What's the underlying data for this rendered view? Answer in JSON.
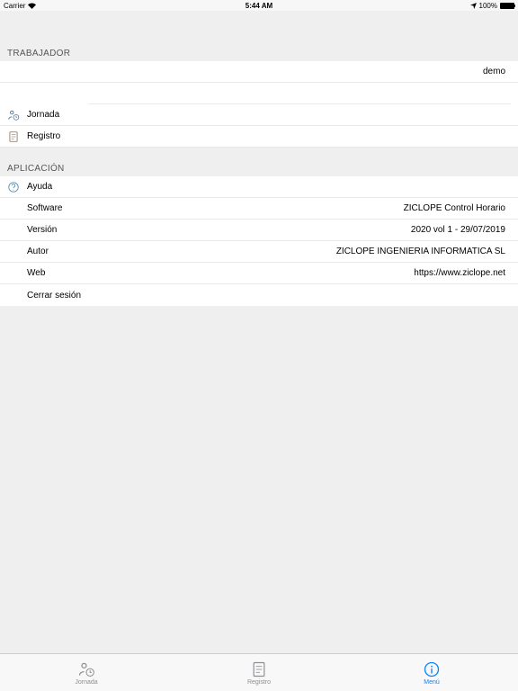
{
  "status": {
    "carrier": "Carrier",
    "time": "5:44 AM",
    "battery": "100%"
  },
  "sections": {
    "trabajador": {
      "header": "TRABAJADOR",
      "user": "demo",
      "jornada": "Jornada",
      "registro": "Registro"
    },
    "aplicacion": {
      "header": "APLICACIÓN",
      "ayuda": "Ayuda",
      "software_label": "Software",
      "software_value": "ZICLOPE Control Horario",
      "version_label": "Versión",
      "version_value": "2020 vol 1 - 29/07/2019",
      "autor_label": "Autor",
      "autor_value": "ZICLOPE INGENIERIA INFORMATICA SL",
      "web_label": "Web",
      "web_value": "https://www.ziclope.net",
      "cerrar": "Cerrar sesión"
    }
  },
  "tabs": {
    "jornada": "Jornada",
    "registro": "Registro",
    "menu": "Menú"
  }
}
